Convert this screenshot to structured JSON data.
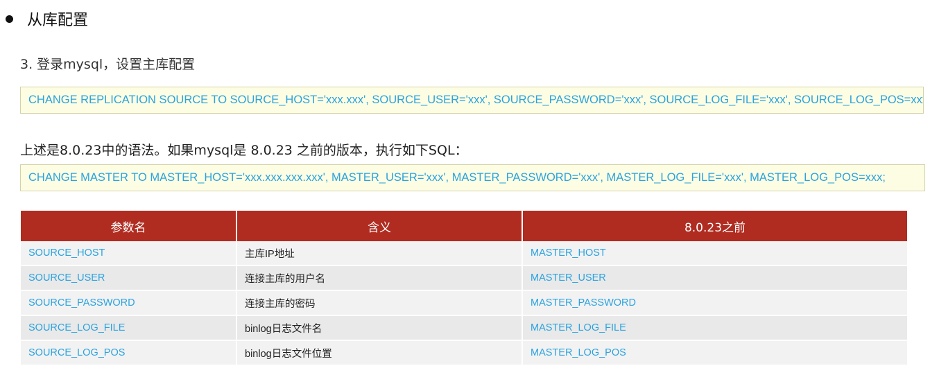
{
  "heading": "从库配置",
  "step": "3. 登录mysql，设置主库配置",
  "code_new": "CHANGE REPLICATION SOURCE TO SOURCE_HOST='xxx.xxx', SOURCE_USER='xxx', SOURCE_PASSWORD='xxx', SOURCE_LOG_FILE='xxx', SOURCE_LOG_POS=xxx;",
  "note": "上述是8.0.23中的语法。如果mysql是 8.0.23 之前的版本，执行如下SQL：",
  "code_old": "CHANGE MASTER TO MASTER_HOST='xxx.xxx.xxx.xxx', MASTER_USER='xxx', MASTER_PASSWORD='xxx', MASTER_LOG_FILE='xxx', MASTER_LOG_POS=xxx;",
  "colors": {
    "header_bg": "#b02c21",
    "code_text": "#2aa3df",
    "code_bg": "#fdfde3"
  },
  "table": {
    "headers": [
      "参数名",
      "含义",
      "8.0.23之前"
    ],
    "rows": [
      [
        "SOURCE_HOST",
        "主库IP地址",
        "MASTER_HOST"
      ],
      [
        "SOURCE_USER",
        "连接主库的用户名",
        "MASTER_USER"
      ],
      [
        "SOURCE_PASSWORD",
        "连接主库的密码",
        "MASTER_PASSWORD"
      ],
      [
        "SOURCE_LOG_FILE",
        "binlog日志文件名",
        "MASTER_LOG_FILE"
      ],
      [
        "SOURCE_LOG_POS",
        "binlog日志文件位置",
        "MASTER_LOG_POS"
      ]
    ]
  }
}
